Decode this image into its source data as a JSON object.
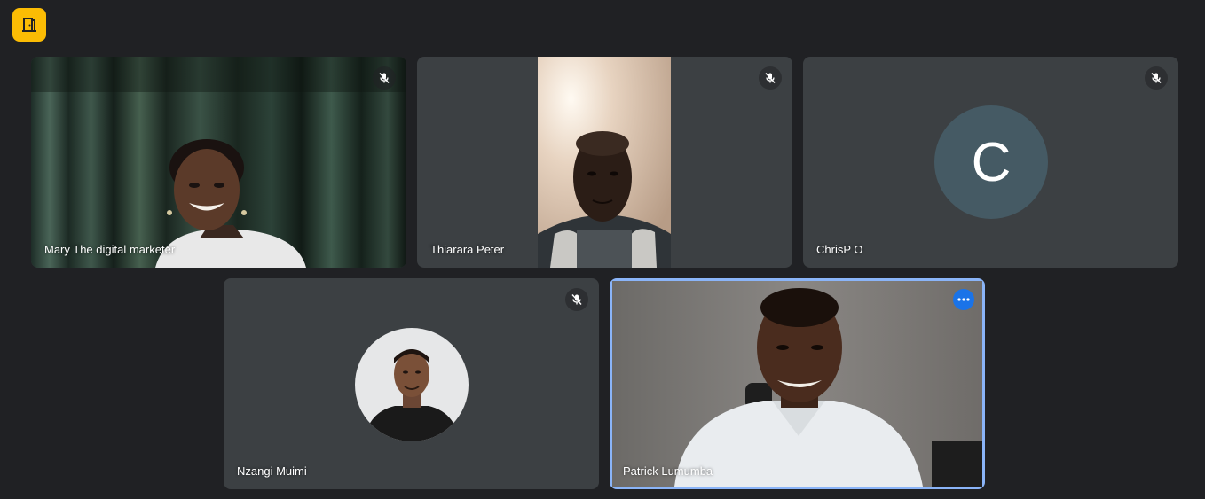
{
  "meeting": {
    "participants": [
      {
        "name": "Mary The digital marketer",
        "muted": true,
        "video": "camera"
      },
      {
        "name": "Thiarara Peter",
        "muted": true,
        "video": "camera"
      },
      {
        "name": "ChrisP O",
        "muted": true,
        "video": "off",
        "initial": "C"
      },
      {
        "name": "Nzangi Muimi",
        "muted": true,
        "video": "off",
        "profile_photo": true
      },
      {
        "name": "Patrick Lumumba",
        "muted": false,
        "video": "camera",
        "active_speaker": true
      }
    ]
  },
  "colors": {
    "background": "#202124",
    "tile": "#3c4043",
    "accent_yellow": "#fbbc04",
    "active_border": "#8ab4f8",
    "more_button": "#1a73e8",
    "avatar_bg": "#455a64"
  },
  "icons": {
    "top_left": "door-exit-icon",
    "muted": "mic-off-icon",
    "more": "more-options-icon"
  }
}
